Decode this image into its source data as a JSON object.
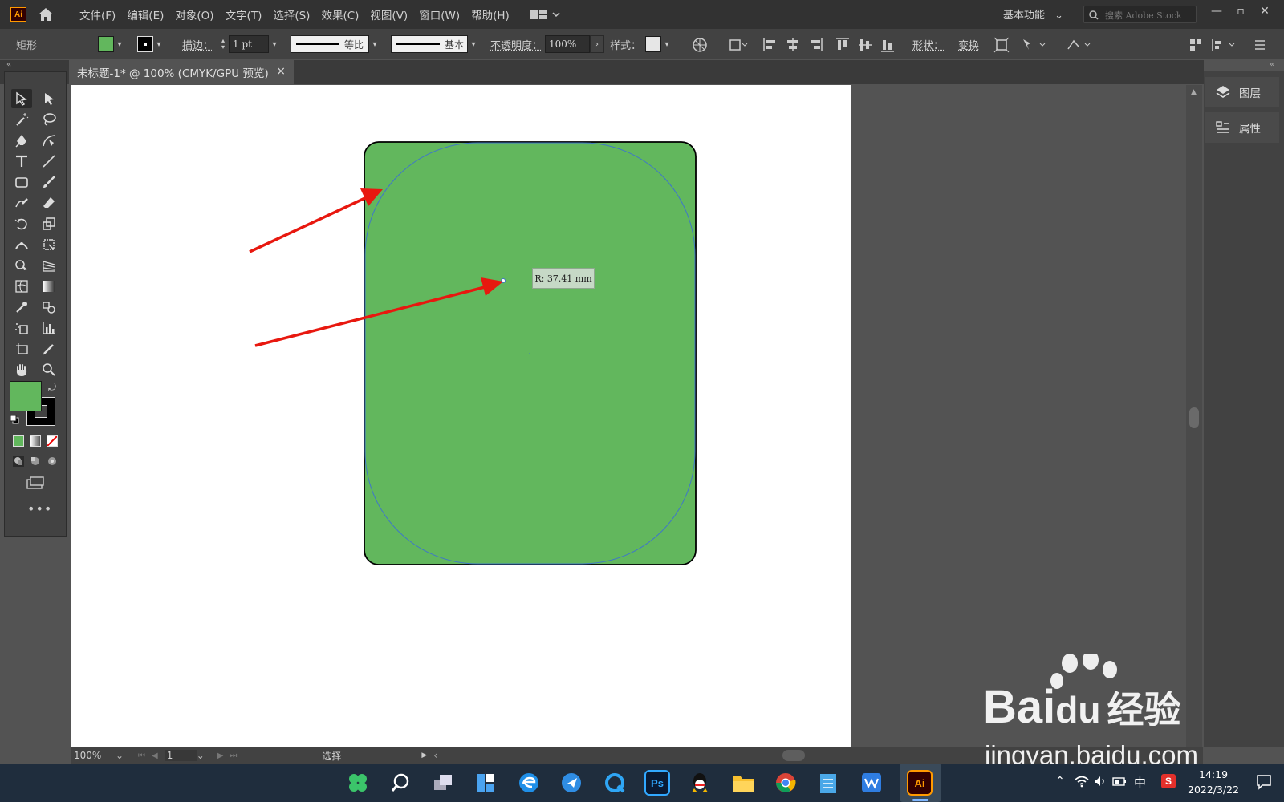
{
  "app": {
    "logo": "Ai",
    "title": "Adobe Illustrator"
  },
  "menu": [
    "文件(F)",
    "编辑(E)",
    "对象(O)",
    "文字(T)",
    "选择(S)",
    "效果(C)",
    "视图(V)",
    "窗口(W)",
    "帮助(H)"
  ],
  "header": {
    "workspace": "基本功能",
    "search_placeholder": "搜索 Adobe Stock"
  },
  "control": {
    "object_type": "矩形",
    "stroke_label": "描边：",
    "stroke_weight": "1 pt",
    "stroke_profile": "等比",
    "brush": "基本",
    "opacity_label": "不透明度：",
    "opacity_value": "100%",
    "style_label": "样式：",
    "shape_label": "形状：",
    "transform_label": "变换"
  },
  "document": {
    "tab_title": "未标题-1* @ 100% (CMYK/GPU 预览)",
    "close": "×"
  },
  "canvas": {
    "tooltip": "R: 37.41 mm"
  },
  "panels": [
    {
      "label": "图层",
      "icon": "layers-icon"
    },
    {
      "label": "属性",
      "icon": "properties-icon"
    }
  ],
  "status": {
    "zoom": "100%",
    "artboard": "1",
    "tool": "选择"
  },
  "taskbar": {
    "apps": [
      "start-icon",
      "search-icon",
      "task-view-icon",
      "widgets-icon",
      "edge-icon",
      "feishu-icon",
      "qq-browser-icon",
      "photoshop-icon",
      "qq-icon",
      "file-explorer-icon",
      "chrome-icon",
      "notepad-icon",
      "wps-icon",
      "illustrator-icon"
    ],
    "ps_label": "Ps",
    "ai_label": "Ai",
    "ime": "中",
    "time": "14:19",
    "date": "2022/3/22"
  },
  "watermark": {
    "brand": "Bai",
    "brand_tail": "du",
    "cn": "经验",
    "url": "jingyan.baidu.com"
  },
  "colors": {
    "fill": "#62b75d",
    "stroke": "#000000",
    "accent": "#ff9a00",
    "menubar": "#323232",
    "panel": "#424242"
  }
}
